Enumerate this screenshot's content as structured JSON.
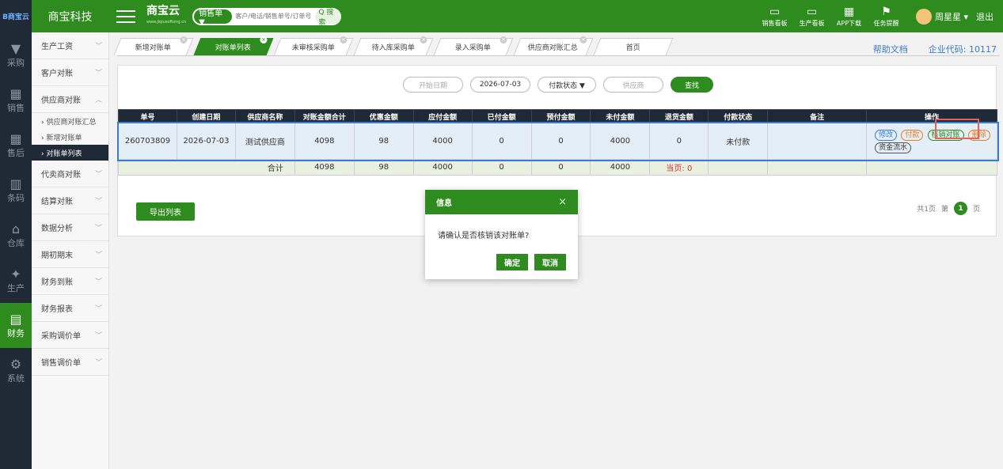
{
  "app": {
    "logo_text": "B商宝云",
    "company": "商宝科技",
    "brand": "商宝云",
    "brand_sub": "www.jiqiusoftong.cn"
  },
  "search": {
    "type": "销售单 ▼",
    "placeholder": "客户/电话/销售单号/订单号",
    "button": "Q 搜索"
  },
  "top_nav": [
    {
      "label": "销售看板",
      "icon": "chart-icon"
    },
    {
      "label": "生产看板",
      "icon": "chart-icon"
    },
    {
      "label": "APP下载",
      "icon": "qrcode-icon"
    },
    {
      "label": "任务提醒",
      "icon": "flag-icon"
    }
  ],
  "user": {
    "name": "周星星 ▾",
    "logout": "退出"
  },
  "rail": [
    {
      "label": "采购",
      "icon": "cart-icon"
    },
    {
      "label": "销售",
      "icon": "grid-icon"
    },
    {
      "label": "售后",
      "icon": "grid-icon"
    },
    {
      "label": "条码",
      "icon": "barcode-icon"
    },
    {
      "label": "仓库",
      "icon": "warehouse-icon"
    },
    {
      "label": "生产",
      "icon": "robot-icon"
    },
    {
      "label": "财务",
      "icon": "calculator-icon",
      "active": true
    },
    {
      "label": "系统",
      "icon": "gear-icon"
    }
  ],
  "sidebar": {
    "items": [
      "生产工资",
      "客户对账",
      "供应商对账",
      "代卖商对账",
      "结算对账",
      "数据分析",
      "期初期末",
      "财务到账",
      "财务报表",
      "采购调价单",
      "销售调价单"
    ],
    "sub_items": [
      "› 供应商对账汇总",
      "› 新增对账单",
      "› 对账单列表"
    ]
  },
  "tabs": [
    "新增对账单",
    "对账单列表",
    "未审核采购单",
    "待入库采购单",
    "录入采购单",
    "供应商对账汇总",
    "首页"
  ],
  "help": {
    "doc": "帮助文档",
    "code": "企业代码: 10117"
  },
  "filters": {
    "start_date": "开始日期",
    "end_date": "2026-07-03",
    "status": "付款状态 ▼",
    "supplier": "供应商",
    "find": "查找"
  },
  "table": {
    "headers": [
      "单号",
      "创建日期",
      "供应商名称",
      "对账金额合计",
      "优惠金额",
      "应付金额",
      "已付金额",
      "预付金额",
      "未付金额",
      "退货金额",
      "付款状态",
      "备注",
      "操作"
    ],
    "row": [
      "260703809",
      "2026-07-03",
      "测试供应商",
      "4098",
      "98",
      "4000",
      "0",
      "0",
      "4000",
      "0",
      "未付款",
      ""
    ],
    "ops": [
      "修改",
      "付款",
      "核销对账",
      "删除",
      "资金流水"
    ],
    "total": {
      "label": "合计",
      "values": [
        "4098",
        "98",
        "4000",
        "0",
        "0",
        "4000"
      ],
      "return": "当页: 0"
    }
  },
  "export": "导出列表",
  "pager": {
    "total": "共1页",
    "prefix": "第",
    "current": "1",
    "suffix": "页"
  },
  "modal": {
    "title": "信息",
    "close": "×",
    "message": "请确认是否核销该对账单?",
    "ok": "确定",
    "cancel": "取消"
  },
  "colors": {
    "primary": "#2e8b1e",
    "dark": "#1f2a36",
    "link": "#3a7bd5",
    "warn": "#e3342f"
  }
}
